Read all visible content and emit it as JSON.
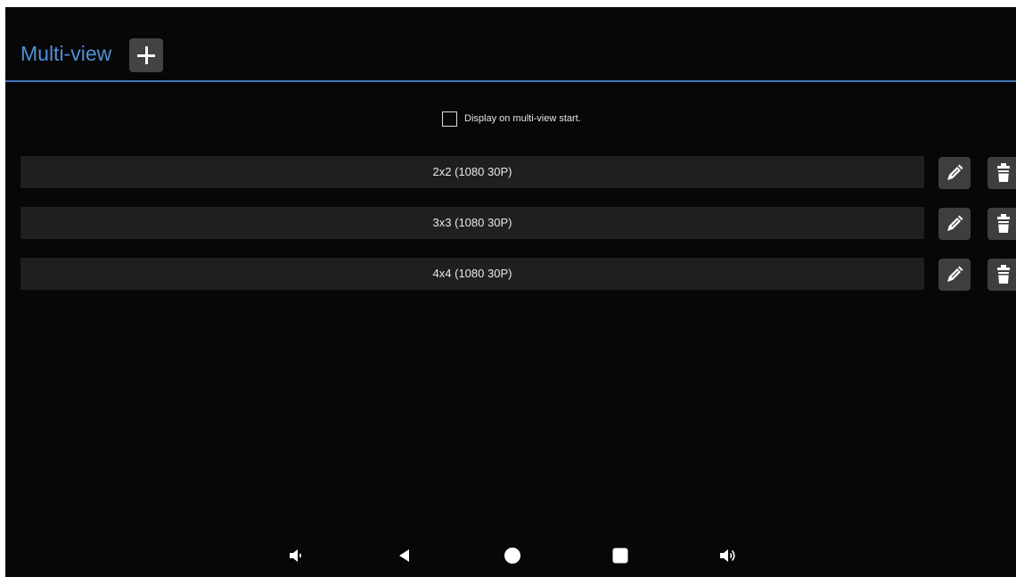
{
  "header": {
    "title": "Multi-view",
    "add_icon": "plus-icon",
    "title_color": "#4f8fd6",
    "divider_color": "#3d73b5"
  },
  "options": {
    "display_on_start_label": "Display on multi-view start.",
    "display_on_start_checked": false
  },
  "layouts": [
    {
      "label": "2x2 (1080 30P)",
      "edit_icon": "pencil-icon",
      "delete_icon": "trash-icon"
    },
    {
      "label": "3x3 (1080 30P)",
      "edit_icon": "pencil-icon",
      "delete_icon": "trash-icon"
    },
    {
      "label": "4x4 (1080 30P)",
      "edit_icon": "pencil-icon",
      "delete_icon": "trash-icon"
    }
  ],
  "navbar": {
    "icons": [
      "volume-down-icon",
      "back-icon",
      "home-icon",
      "recents-icon",
      "volume-up-icon"
    ]
  }
}
